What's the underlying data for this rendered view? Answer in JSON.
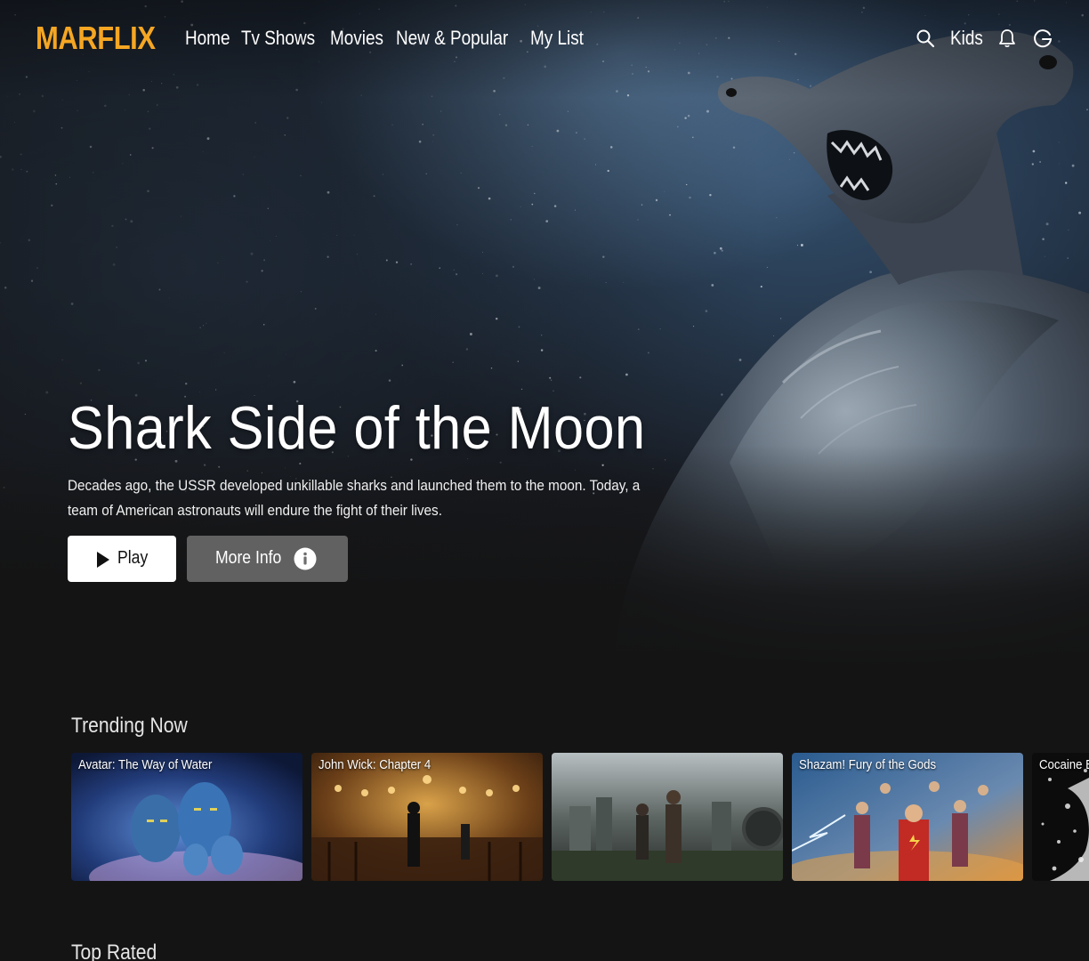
{
  "brand": {
    "logo_text": "MARFLIX",
    "accent_color": "#f5a623"
  },
  "nav": {
    "links": [
      {
        "label": "Home"
      },
      {
        "label": "Tv Shows"
      },
      {
        "label": "Movies"
      },
      {
        "label": "New & Popular"
      },
      {
        "label": "My List"
      }
    ],
    "search_icon": "search-icon",
    "kids_label": "Kids",
    "notifications_icon": "bell-icon",
    "profile_icon": "google-icon"
  },
  "hero": {
    "title": "Shark Side of the Moon",
    "description": "Decades ago, the USSR developed unkillable sharks and launched them to the moon. Today, a team of American astronauts will endure the fight of their lives.",
    "play_label": "Play",
    "more_info_label": "More Info",
    "play_icon": "play-icon",
    "info_icon": "info-icon"
  },
  "rows": [
    {
      "title": "Trending Now",
      "items": [
        {
          "title": "Avatar: The Way of Water"
        },
        {
          "title": "John Wick: Chapter 4"
        },
        {
          "title": ""
        },
        {
          "title": "Shazam! Fury of the Gods"
        },
        {
          "title": "Cocaine Bear"
        }
      ]
    },
    {
      "title": "Top Rated"
    }
  ]
}
